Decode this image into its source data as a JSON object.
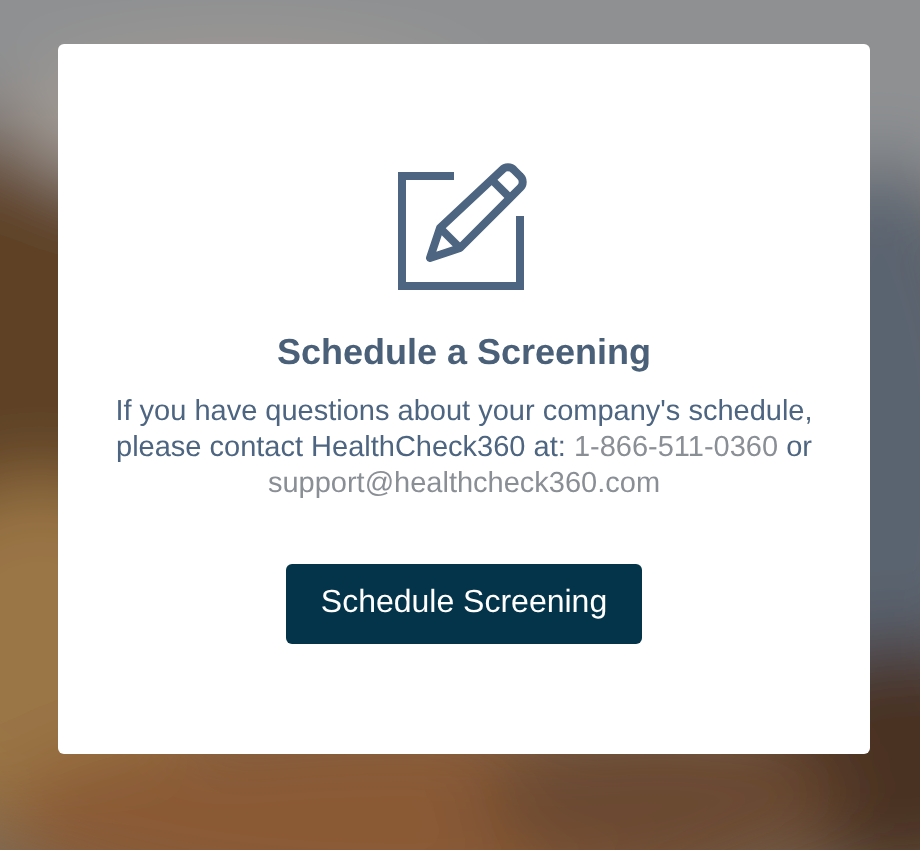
{
  "dialog": {
    "title": "Schedule a Screening",
    "message": {
      "text": "If you have questions about your company's schedule, please contact HealthCheck360 at:",
      "phone": "1-866-511-0360",
      "connector": "or",
      "email": "support@healthcheck360.com"
    },
    "button": "Schedule Screening"
  }
}
